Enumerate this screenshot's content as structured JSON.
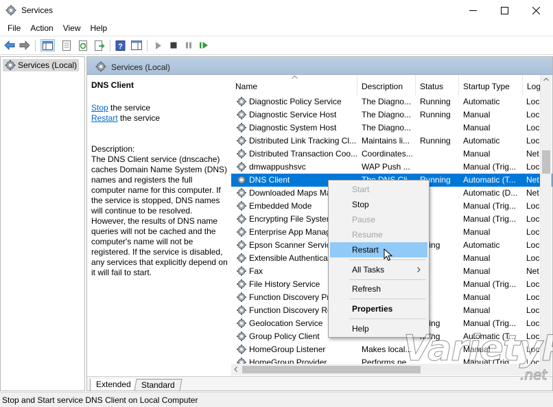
{
  "window": {
    "title": "Services",
    "icon": "gear-icon"
  },
  "menu": [
    "File",
    "Action",
    "View",
    "Help"
  ],
  "toolbar_icons": [
    "back-arrow-icon",
    "forward-arrow-icon",
    "console-tree-icon",
    "properties-icon",
    "refresh-icon",
    "export-list-icon",
    "help-icon",
    "show-hide-icon",
    "play-icon",
    "stop-icon",
    "pause-icon",
    "restart-icon"
  ],
  "tree": {
    "item": "Services (Local)"
  },
  "pane": {
    "header": "Services (Local)",
    "selected_service": "DNS Client",
    "actions": [
      {
        "link": "Stop",
        "text": " the service"
      },
      {
        "link": "Restart",
        "text": " the service"
      }
    ],
    "description_label": "Description:",
    "description": "The DNS Client service (dnscache) caches Domain Name System (DNS) names and registers the full computer name for this computer. If the service is stopped, DNS names will continue to be resolved. However, the results of DNS name queries will not be cached and the computer's name will not be registered. If the service is disabled, any services that explicitly depend on it will fail to start."
  },
  "columns": [
    "Name",
    "Description",
    "Status",
    "Startup Type",
    "Log"
  ],
  "rows": [
    {
      "name": "Diagnostic Policy Service",
      "desc": "The Diagno...",
      "status": "Running",
      "startup": "Automatic",
      "log": "Loc"
    },
    {
      "name": "Diagnostic Service Host",
      "desc": "The Diagno...",
      "status": "Running",
      "startup": "Manual",
      "log": "Loc"
    },
    {
      "name": "Diagnostic System Host",
      "desc": "The Diagno...",
      "status": "",
      "startup": "Manual",
      "log": "Loc"
    },
    {
      "name": "Distributed Link Tracking Cl...",
      "desc": "Maintains li...",
      "status": "Running",
      "startup": "Automatic",
      "log": "Loc"
    },
    {
      "name": "Distributed Transaction Coo...",
      "desc": "Coordinates...",
      "status": "",
      "startup": "Manual",
      "log": "Net"
    },
    {
      "name": "dmwappushsvc",
      "desc": "WAP Push ...",
      "status": "",
      "startup": "Manual (Trig...",
      "log": "Loc"
    },
    {
      "name": "DNS Client",
      "desc": "The DNS Cli...",
      "status": "Running",
      "startup": "Automatic (T...",
      "log": "Net"
    },
    {
      "name": "Downloaded Maps Ma",
      "desc": "",
      "status": "",
      "startup": "Automatic (D...",
      "log": "Net"
    },
    {
      "name": "Embedded Mode",
      "desc": "",
      "status": "",
      "startup": "Manual (Trig...",
      "log": "Loc"
    },
    {
      "name": "Encrypting File System",
      "desc": "",
      "status": "",
      "startup": "Manual (Trig...",
      "log": "Loc"
    },
    {
      "name": "Enterprise App Manag",
      "desc": "",
      "status": "",
      "startup": "Manual",
      "log": "Loc"
    },
    {
      "name": "Epson Scanner Service",
      "desc": "",
      "status": "nning",
      "startup": "Automatic",
      "log": "Loc"
    },
    {
      "name": "Extensible Authenticat",
      "desc": "",
      "status": "",
      "startup": "Manual",
      "log": "Loc"
    },
    {
      "name": "Fax",
      "desc": "",
      "status": "",
      "startup": "Manual",
      "log": "Net"
    },
    {
      "name": "File History Service",
      "desc": "",
      "status": "",
      "startup": "Manual (Trig...",
      "log": "Loc"
    },
    {
      "name": "Function Discovery Pr",
      "desc": "",
      "status": "",
      "startup": "Manual",
      "log": "Loc"
    },
    {
      "name": "Function Discovery Re",
      "desc": "",
      "status": "",
      "startup": "Manual",
      "log": "Loc"
    },
    {
      "name": "Geolocation Service",
      "desc": "",
      "status": "nning",
      "startup": "Manual (Trig...",
      "log": "Loc"
    },
    {
      "name": "Group Policy Client",
      "desc": "",
      "status": "nning",
      "startup": "Automatic (T...",
      "log": "Loc"
    },
    {
      "name": "HomeGroup Listener",
      "desc": "Makes local...",
      "status": "",
      "startup": "Manual",
      "log": "Loc"
    },
    {
      "name": "HomeGroup Provider",
      "desc": "Performs ne...",
      "status": "",
      "startup": "Manual (Trig...",
      "log": "Loc"
    }
  ],
  "context_menu": [
    {
      "label": "Start",
      "state": "disabled"
    },
    {
      "label": "Stop",
      "state": "enabled"
    },
    {
      "label": "Pause",
      "state": "disabled"
    },
    {
      "label": "Resume",
      "state": "disabled"
    },
    {
      "label": "Restart",
      "state": "hover"
    },
    {
      "label": "All Tasks",
      "state": "submenu"
    },
    {
      "label": "Refresh",
      "state": "enabled"
    },
    {
      "label": "Properties",
      "state": "default"
    },
    {
      "label": "Help",
      "state": "enabled"
    }
  ],
  "tabs": [
    "Extended",
    "Standard"
  ],
  "status_bar": "Stop and Start service DNS Client on Local Computer",
  "watermark": {
    "main": "VarietyPC",
    "suffix": ".net"
  },
  "colors": {
    "selection": "#0078d7",
    "menu_hover": "#91c9f7",
    "link": "#0066cc",
    "header": "#bcd0e5"
  }
}
